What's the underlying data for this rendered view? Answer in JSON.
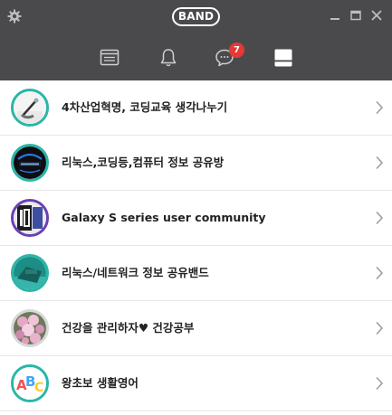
{
  "app": {
    "logo_text": "BAND"
  },
  "window_controls": {
    "minimize_icon": "minimize-icon",
    "maximize_icon": "maximize-icon",
    "close_icon": "close-icon"
  },
  "nav": {
    "tabs": [
      {
        "icon": "feed-icon"
      },
      {
        "icon": "bell-icon"
      },
      {
        "icon": "chat-icon",
        "badge": "7"
      },
      {
        "icon": "bands-icon",
        "selected": true
      }
    ]
  },
  "bands": [
    {
      "name": "4차산업혁명, 코딩교육 생각나누기",
      "avatar": "writing-avatar",
      "ring": "#2ab6a8"
    },
    {
      "name": "리눅스,코딩등,컴퓨터 정보 공유방",
      "avatar": "dark-logo-avatar",
      "ring": "#2ab6a8"
    },
    {
      "name": "Galaxy S series user community",
      "avatar": "s10-avatar",
      "ring": "#6a3fb5"
    },
    {
      "name": "리눅스/네트워크 정보 공유밴드",
      "avatar": "teal-device-avatar",
      "ring": "#2ab6a8"
    },
    {
      "name": "건강을 관리하자♥ 건강공부",
      "avatar": "flowers-avatar",
      "ring": "#d8d8d8"
    },
    {
      "name": "왕초보 생활영어",
      "avatar": "abc-avatar",
      "ring": "#2ab6a8"
    }
  ],
  "colors": {
    "header": "#4a4a4d",
    "badge": "#e53935",
    "accent": "#2ab6a8"
  }
}
